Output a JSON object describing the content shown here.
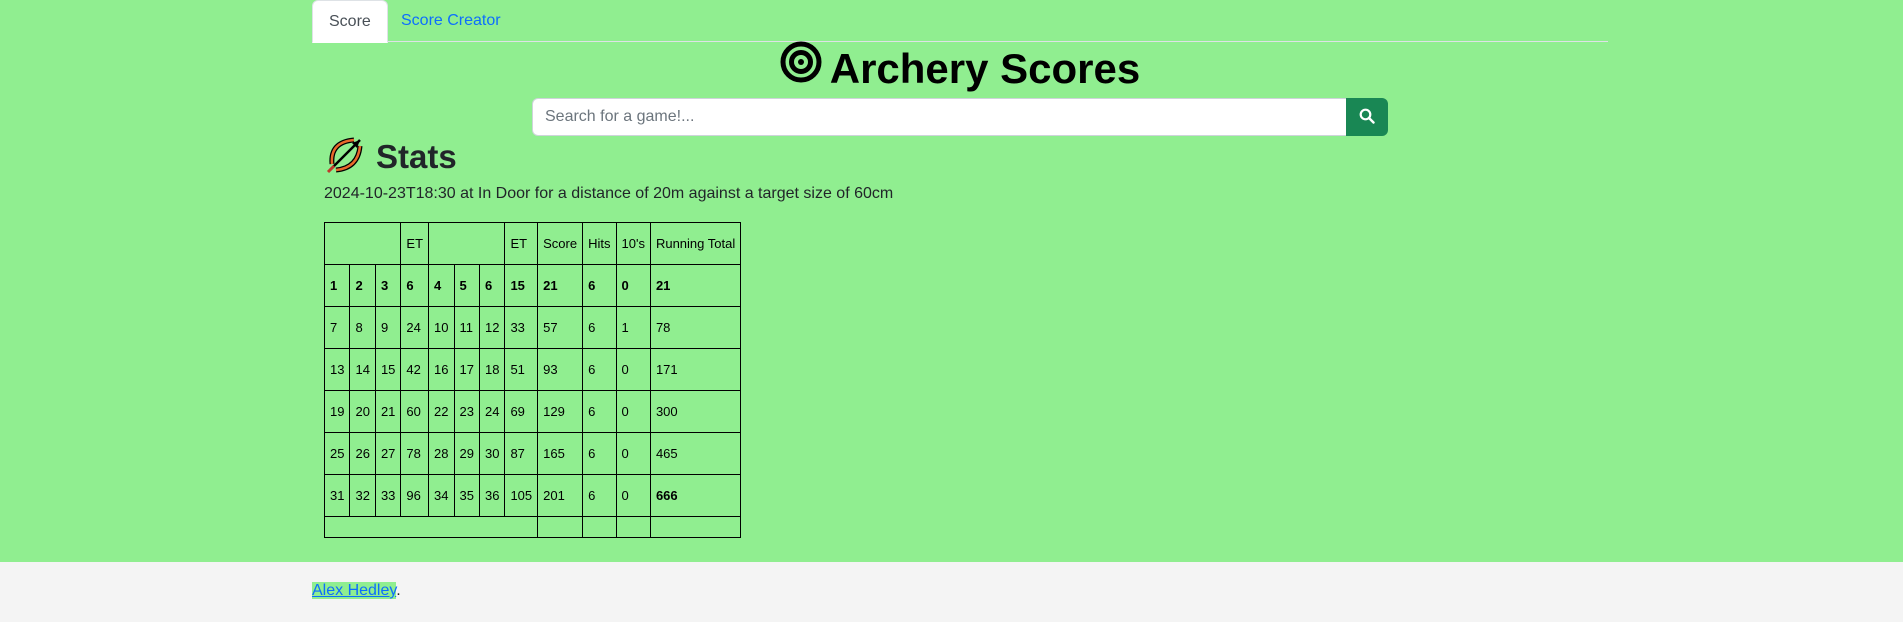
{
  "tabs": [
    {
      "label": "Score"
    },
    {
      "label": "Score Creator"
    }
  ],
  "header": {
    "title": "Archery Scores"
  },
  "search": {
    "placeholder": "Search for a game!..."
  },
  "stats": {
    "heading": "Stats",
    "description": "2024-10-23T18:30 at In Door for a distance of 20m against a target size of 60cm"
  },
  "table": {
    "header": [
      "",
      "ET",
      "",
      "ET",
      "Score",
      "Hits",
      "10's",
      "Running Total"
    ],
    "rows": [
      [
        "1",
        "2",
        "3",
        "6",
        "4",
        "5",
        "6",
        "15",
        "21",
        "6",
        "0",
        "21"
      ],
      [
        "7",
        "8",
        "9",
        "24",
        "10",
        "11",
        "12",
        "33",
        "57",
        "6",
        "1",
        "78"
      ],
      [
        "13",
        "14",
        "15",
        "42",
        "16",
        "17",
        "18",
        "51",
        "93",
        "6",
        "0",
        "171"
      ],
      [
        "19",
        "20",
        "21",
        "60",
        "22",
        "23",
        "24",
        "69",
        "129",
        "6",
        "0",
        "300"
      ],
      [
        "25",
        "26",
        "27",
        "78",
        "28",
        "29",
        "30",
        "87",
        "165",
        "6",
        "0",
        "465"
      ],
      [
        "31",
        "32",
        "33",
        "96",
        "34",
        "35",
        "36",
        "105",
        "201",
        "6",
        "0",
        "666"
      ]
    ]
  },
  "footer": {
    "author": "Alex Hedley",
    "suffix": "."
  },
  "colors": {
    "background": "#90ee90",
    "search_button": "#198754",
    "link": "#0d6efd"
  }
}
